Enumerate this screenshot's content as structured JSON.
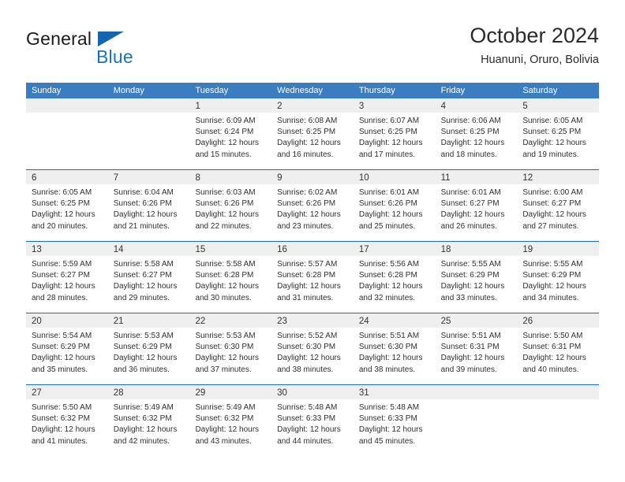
{
  "brand": {
    "name_part1": "General",
    "name_part2": "Blue",
    "flag_icon": "triangle-flag-icon",
    "accent_color": "#1572c4"
  },
  "header": {
    "month_title": "October 2024",
    "location": "Huanuni, Oruro, Bolivia"
  },
  "calendar": {
    "header_bg": "#3a7dc0",
    "row_divider_color": "#1a6cb5",
    "day_band_bg": "#efefef",
    "weekdays": [
      "Sunday",
      "Monday",
      "Tuesday",
      "Wednesday",
      "Thursday",
      "Friday",
      "Saturday"
    ],
    "weeks": [
      [
        {
          "day": "",
          "empty": true
        },
        {
          "day": "",
          "empty": true
        },
        {
          "day": "1",
          "sunrise": "Sunrise: 6:09 AM",
          "sunset": "Sunset: 6:24 PM",
          "daylight_1": "Daylight: 12 hours",
          "daylight_2": "and 15 minutes."
        },
        {
          "day": "2",
          "sunrise": "Sunrise: 6:08 AM",
          "sunset": "Sunset: 6:25 PM",
          "daylight_1": "Daylight: 12 hours",
          "daylight_2": "and 16 minutes."
        },
        {
          "day": "3",
          "sunrise": "Sunrise: 6:07 AM",
          "sunset": "Sunset: 6:25 PM",
          "daylight_1": "Daylight: 12 hours",
          "daylight_2": "and 17 minutes."
        },
        {
          "day": "4",
          "sunrise": "Sunrise: 6:06 AM",
          "sunset": "Sunset: 6:25 PM",
          "daylight_1": "Daylight: 12 hours",
          "daylight_2": "and 18 minutes."
        },
        {
          "day": "5",
          "sunrise": "Sunrise: 6:05 AM",
          "sunset": "Sunset: 6:25 PM",
          "daylight_1": "Daylight: 12 hours",
          "daylight_2": "and 19 minutes."
        }
      ],
      [
        {
          "day": "6",
          "sunrise": "Sunrise: 6:05 AM",
          "sunset": "Sunset: 6:25 PM",
          "daylight_1": "Daylight: 12 hours",
          "daylight_2": "and 20 minutes."
        },
        {
          "day": "7",
          "sunrise": "Sunrise: 6:04 AM",
          "sunset": "Sunset: 6:26 PM",
          "daylight_1": "Daylight: 12 hours",
          "daylight_2": "and 21 minutes."
        },
        {
          "day": "8",
          "sunrise": "Sunrise: 6:03 AM",
          "sunset": "Sunset: 6:26 PM",
          "daylight_1": "Daylight: 12 hours",
          "daylight_2": "and 22 minutes."
        },
        {
          "day": "9",
          "sunrise": "Sunrise: 6:02 AM",
          "sunset": "Sunset: 6:26 PM",
          "daylight_1": "Daylight: 12 hours",
          "daylight_2": "and 23 minutes."
        },
        {
          "day": "10",
          "sunrise": "Sunrise: 6:01 AM",
          "sunset": "Sunset: 6:26 PM",
          "daylight_1": "Daylight: 12 hours",
          "daylight_2": "and 25 minutes."
        },
        {
          "day": "11",
          "sunrise": "Sunrise: 6:01 AM",
          "sunset": "Sunset: 6:27 PM",
          "daylight_1": "Daylight: 12 hours",
          "daylight_2": "and 26 minutes."
        },
        {
          "day": "12",
          "sunrise": "Sunrise: 6:00 AM",
          "sunset": "Sunset: 6:27 PM",
          "daylight_1": "Daylight: 12 hours",
          "daylight_2": "and 27 minutes."
        }
      ],
      [
        {
          "day": "13",
          "sunrise": "Sunrise: 5:59 AM",
          "sunset": "Sunset: 6:27 PM",
          "daylight_1": "Daylight: 12 hours",
          "daylight_2": "and 28 minutes."
        },
        {
          "day": "14",
          "sunrise": "Sunrise: 5:58 AM",
          "sunset": "Sunset: 6:27 PM",
          "daylight_1": "Daylight: 12 hours",
          "daylight_2": "and 29 minutes."
        },
        {
          "day": "15",
          "sunrise": "Sunrise: 5:58 AM",
          "sunset": "Sunset: 6:28 PM",
          "daylight_1": "Daylight: 12 hours",
          "daylight_2": "and 30 minutes."
        },
        {
          "day": "16",
          "sunrise": "Sunrise: 5:57 AM",
          "sunset": "Sunset: 6:28 PM",
          "daylight_1": "Daylight: 12 hours",
          "daylight_2": "and 31 minutes."
        },
        {
          "day": "17",
          "sunrise": "Sunrise: 5:56 AM",
          "sunset": "Sunset: 6:28 PM",
          "daylight_1": "Daylight: 12 hours",
          "daylight_2": "and 32 minutes."
        },
        {
          "day": "18",
          "sunrise": "Sunrise: 5:55 AM",
          "sunset": "Sunset: 6:29 PM",
          "daylight_1": "Daylight: 12 hours",
          "daylight_2": "and 33 minutes."
        },
        {
          "day": "19",
          "sunrise": "Sunrise: 5:55 AM",
          "sunset": "Sunset: 6:29 PM",
          "daylight_1": "Daylight: 12 hours",
          "daylight_2": "and 34 minutes."
        }
      ],
      [
        {
          "day": "20",
          "sunrise": "Sunrise: 5:54 AM",
          "sunset": "Sunset: 6:29 PM",
          "daylight_1": "Daylight: 12 hours",
          "daylight_2": "and 35 minutes."
        },
        {
          "day": "21",
          "sunrise": "Sunrise: 5:53 AM",
          "sunset": "Sunset: 6:29 PM",
          "daylight_1": "Daylight: 12 hours",
          "daylight_2": "and 36 minutes."
        },
        {
          "day": "22",
          "sunrise": "Sunrise: 5:53 AM",
          "sunset": "Sunset: 6:30 PM",
          "daylight_1": "Daylight: 12 hours",
          "daylight_2": "and 37 minutes."
        },
        {
          "day": "23",
          "sunrise": "Sunrise: 5:52 AM",
          "sunset": "Sunset: 6:30 PM",
          "daylight_1": "Daylight: 12 hours",
          "daylight_2": "and 38 minutes."
        },
        {
          "day": "24",
          "sunrise": "Sunrise: 5:51 AM",
          "sunset": "Sunset: 6:30 PM",
          "daylight_1": "Daylight: 12 hours",
          "daylight_2": "and 38 minutes."
        },
        {
          "day": "25",
          "sunrise": "Sunrise: 5:51 AM",
          "sunset": "Sunset: 6:31 PM",
          "daylight_1": "Daylight: 12 hours",
          "daylight_2": "and 39 minutes."
        },
        {
          "day": "26",
          "sunrise": "Sunrise: 5:50 AM",
          "sunset": "Sunset: 6:31 PM",
          "daylight_1": "Daylight: 12 hours",
          "daylight_2": "and 40 minutes."
        }
      ],
      [
        {
          "day": "27",
          "sunrise": "Sunrise: 5:50 AM",
          "sunset": "Sunset: 6:32 PM",
          "daylight_1": "Daylight: 12 hours",
          "daylight_2": "and 41 minutes."
        },
        {
          "day": "28",
          "sunrise": "Sunrise: 5:49 AM",
          "sunset": "Sunset: 6:32 PM",
          "daylight_1": "Daylight: 12 hours",
          "daylight_2": "and 42 minutes."
        },
        {
          "day": "29",
          "sunrise": "Sunrise: 5:49 AM",
          "sunset": "Sunset: 6:32 PM",
          "daylight_1": "Daylight: 12 hours",
          "daylight_2": "and 43 minutes."
        },
        {
          "day": "30",
          "sunrise": "Sunrise: 5:48 AM",
          "sunset": "Sunset: 6:33 PM",
          "daylight_1": "Daylight: 12 hours",
          "daylight_2": "and 44 minutes."
        },
        {
          "day": "31",
          "sunrise": "Sunrise: 5:48 AM",
          "sunset": "Sunset: 6:33 PM",
          "daylight_1": "Daylight: 12 hours",
          "daylight_2": "and 45 minutes."
        },
        {
          "day": "",
          "empty": true
        },
        {
          "day": "",
          "empty": true
        }
      ]
    ]
  }
}
